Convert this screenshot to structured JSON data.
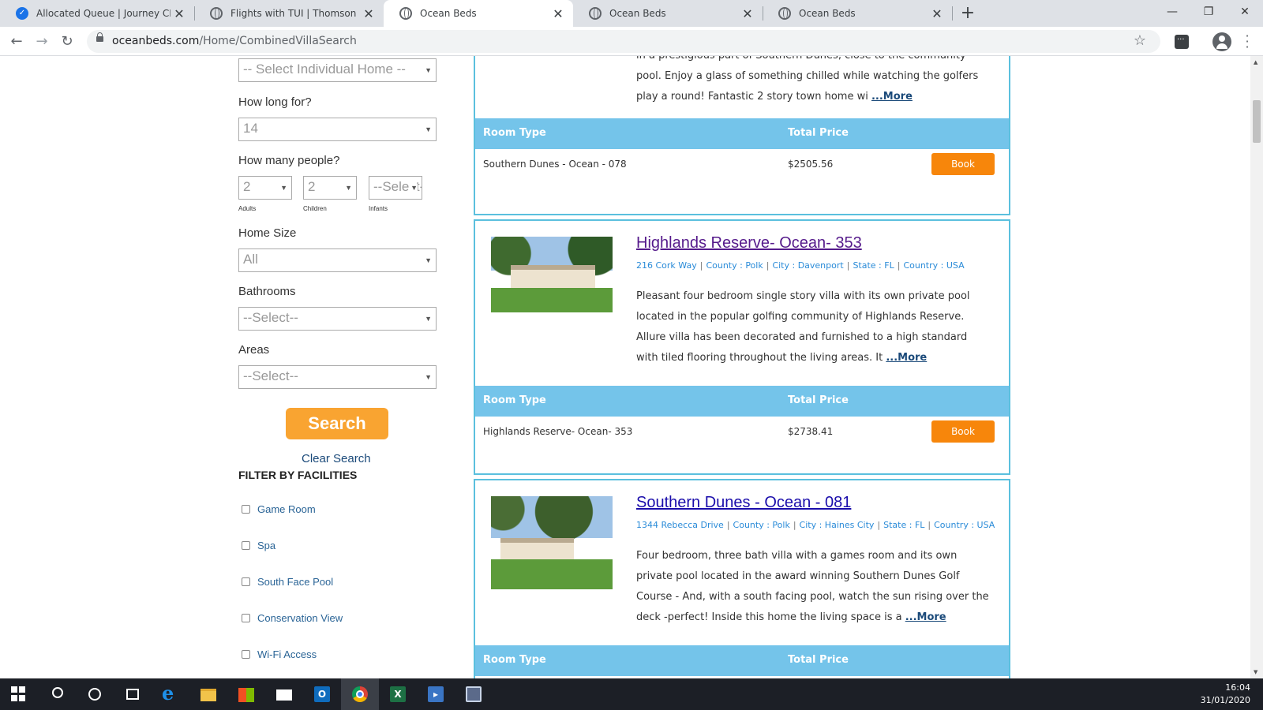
{
  "browser": {
    "tabs": [
      {
        "title": "Allocated Queue | Journey CRM",
        "icon": "check-icon",
        "active": false
      },
      {
        "title": "Flights with TUI | Thomson now T",
        "icon": "globe-icon",
        "active": false
      },
      {
        "title": "Ocean Beds",
        "icon": "globe-icon",
        "active": true
      },
      {
        "title": "Ocean Beds",
        "icon": "globe-icon",
        "active": false
      },
      {
        "title": "Ocean Beds",
        "icon": "globe-icon",
        "active": false
      }
    ],
    "new_tab": "+",
    "url_host": "oceanbeds.com",
    "url_path": "/Home/CombinedVillaSearch"
  },
  "search_panel": {
    "individual_home": "-- Select Individual Home --",
    "how_long_label": "How long for?",
    "how_long_value": "14",
    "people_label": "How many people?",
    "adults_value": "2",
    "children_value": "2",
    "infants_value": "--Select--",
    "adults_label": "Adults",
    "children_label": "Children",
    "infants_label": "Infants",
    "home_size_label": "Home Size",
    "home_size_value": "All",
    "bathrooms_label": "Bathrooms",
    "bathrooms_value": "--Select--",
    "areas_label": "Areas",
    "areas_value": "--Select--",
    "search_button": "Search",
    "clear_link": "Clear Search",
    "filter_title": "FILTER BY FACILITIES",
    "facilities": [
      "Game Room",
      "Spa",
      "South Face Pool",
      "Conservation View",
      "Wi-Fi Access"
    ]
  },
  "results": {
    "col_room_type": "Room Type",
    "col_total_price": "Total Price",
    "book_label": "Book",
    "more_label": "...More",
    "card0": {
      "desc": "in a prestigious part of Southern Dunes, close to the community pool. Enjoy a glass of something chilled while watching the golfers play a round! Fantastic 2 story town home wi ",
      "room_type": "Southern Dunes - Ocean - 078",
      "price": "$2505.56"
    },
    "card1": {
      "name": "Highlands Reserve- Ocean- 353",
      "street": "216 Cork Way",
      "county": "County : Polk",
      "city": "City : Davenport",
      "state": "State : FL",
      "country": "Country : USA",
      "desc": "Pleasant four bedroom single story villa with its own private pool located in the popular golfing community of Highlands Reserve. Allure villa has been decorated and furnished to a high standard with tiled flooring throughout the living areas. It ",
      "room_type": "Highlands Reserve- Ocean- 353",
      "price": "$2738.41"
    },
    "card2": {
      "name": "Southern Dunes - Ocean - 081",
      "street": "1344 Rebecca Drive",
      "county": "County : Polk",
      "city": "City : Haines City",
      "state": "State : FL",
      "country": "Country : USA",
      "desc": "Four bedroom, three bath villa with a games room and its own private pool located in the award winning Southern Dunes Golf Course - And, with a south facing pool, watch the sun rising over the deck -perfect! Inside this home the living space is a "
    }
  },
  "taskbar": {
    "time": "16:04",
    "date": "31/01/2020"
  }
}
